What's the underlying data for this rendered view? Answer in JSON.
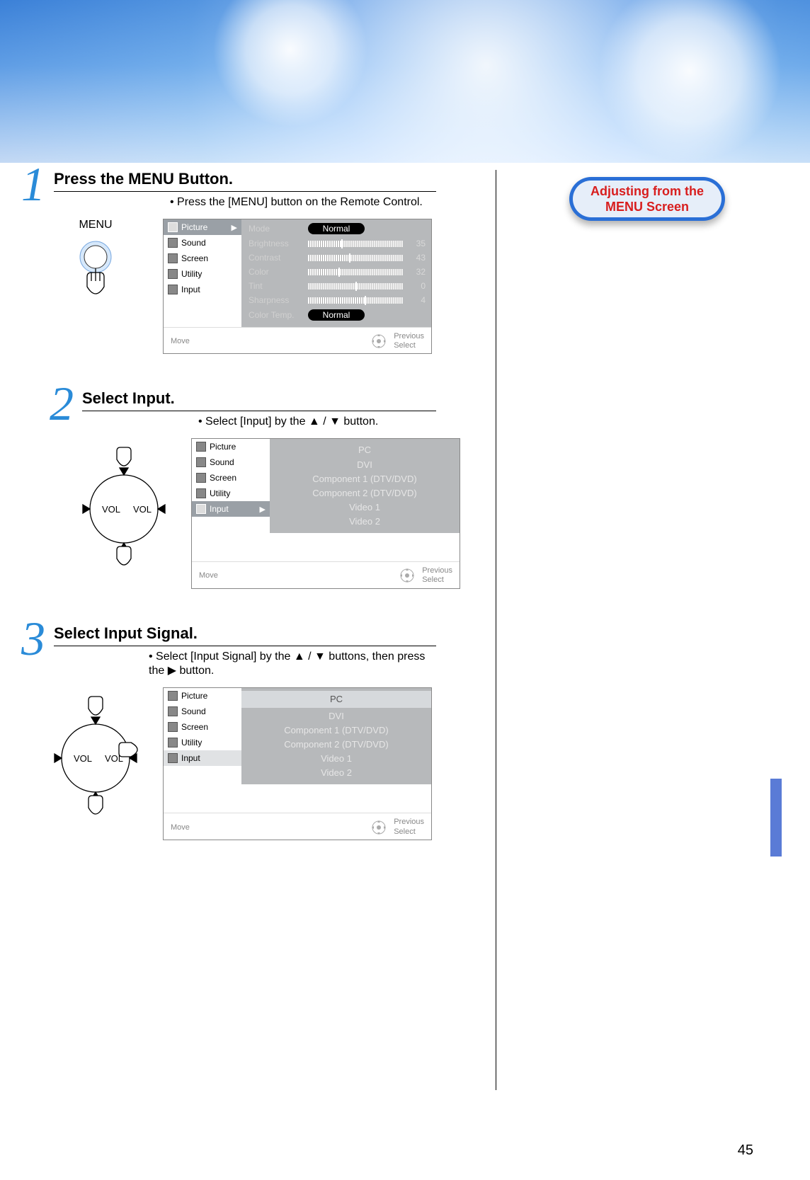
{
  "callout": {
    "line1": "Adjusting from the",
    "line2": "MENU Screen"
  },
  "page_number": "45",
  "remote": {
    "menu_label": "MENU",
    "vol_left": "VOL",
    "vol_right": "VOL"
  },
  "nav_items": [
    "Picture",
    "Sound",
    "Screen",
    "Utility",
    "Input"
  ],
  "osd_footer": {
    "move": "Move",
    "previous": "Previous",
    "select": "Select"
  },
  "steps": [
    {
      "num": "1",
      "title": "Press the MENU Button.",
      "bullet": "• Press the [MENU] button on the Remote Control.",
      "selected_nav": "Picture",
      "picture_settings": {
        "mode": {
          "label": "Mode",
          "value": "Normal"
        },
        "brightness": {
          "label": "Brightness",
          "value": 35,
          "max": 100
        },
        "contrast": {
          "label": "Contrast",
          "value": 43,
          "max": 100
        },
        "color": {
          "label": "Color",
          "value": 32,
          "max": 100
        },
        "tint": {
          "label": "Tint",
          "value": 0,
          "max": 100
        },
        "sharpness": {
          "label": "Sharpness",
          "value": 4,
          "max": 100
        },
        "color_temp": {
          "label": "Color Temp.",
          "value": "Normal"
        }
      }
    },
    {
      "num": "2",
      "title": "Select Input.",
      "bullet": "• Select [Input] by the ▲ / ▼ button.",
      "selected_nav": "Input",
      "input_list": [
        "PC",
        "DVI",
        "Component 1 (DTV/DVD)",
        "Component 2 (DTV/DVD)",
        "Video 1",
        "Video 2"
      ],
      "highlighted_input": null
    },
    {
      "num": "3",
      "title": "Select Input Signal.",
      "bullet": "• Select [Input Signal] by the ▲ / ▼ buttons, then press the ▶ button.",
      "selected_nav": "Input",
      "selected_nav_style": "white",
      "input_list": [
        "PC",
        "DVI",
        "Component 1 (DTV/DVD)",
        "Component 2 (DTV/DVD)",
        "Video 1",
        "Video 2"
      ],
      "highlighted_input": "PC"
    }
  ]
}
